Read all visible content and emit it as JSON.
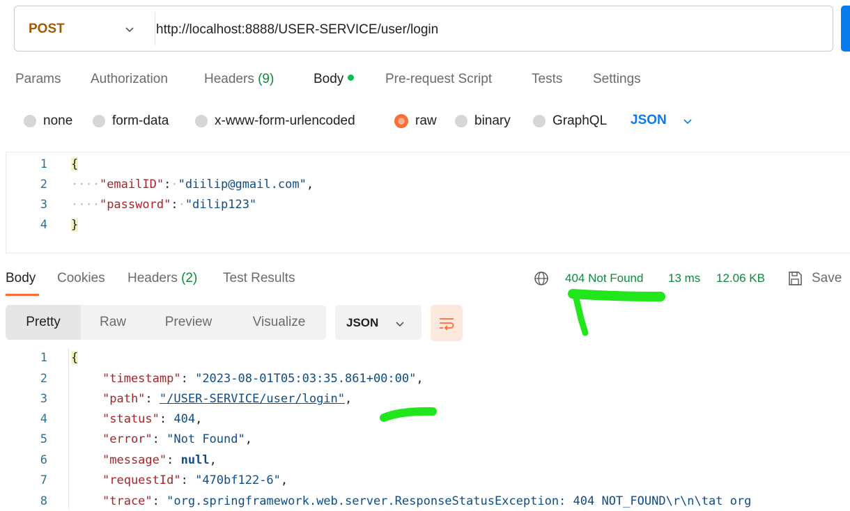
{
  "request": {
    "method": "POST",
    "url": "http://localhost:8888/USER-SERVICE/user/login",
    "tabs": {
      "params": "Params",
      "authorization": "Authorization",
      "headers": "Headers",
      "headers_count": "(9)",
      "body": "Body",
      "prerequest": "Pre-request Script",
      "tests": "Tests",
      "settings": "Settings"
    },
    "body_modes": {
      "none": "none",
      "form_data": "form-data",
      "urlencoded": "x-www-form-urlencoded",
      "raw": "raw",
      "binary": "binary",
      "graphql": "GraphQL",
      "selected": "raw"
    },
    "format": "JSON",
    "lines": [
      {
        "n": "1",
        "text": "{"
      },
      {
        "n": "2",
        "key": "\"emailID\"",
        "value": "\"diilip@gmail.com\""
      },
      {
        "n": "3",
        "key": "\"password\"",
        "value": "\"dilip123\""
      },
      {
        "n": "4",
        "text": "}"
      }
    ]
  },
  "response": {
    "tabs": {
      "body": "Body",
      "cookies": "Cookies",
      "headers": "Headers",
      "headers_count": "(2)",
      "test_results": "Test Results"
    },
    "status": "404 Not Found",
    "time": "13 ms",
    "size": "12.06 KB",
    "save": "Save",
    "views": {
      "pretty": "Pretty",
      "raw": "Raw",
      "preview": "Preview",
      "visualize": "Visualize",
      "selected": "Pretty"
    },
    "format": "JSON",
    "lines": [
      {
        "n": "1",
        "text": "{"
      },
      {
        "n": "2",
        "key": "\"timestamp\"",
        "value": "\"2023-08-01T05:03:35.861+00:00\"",
        "tail": ","
      },
      {
        "n": "3",
        "key": "\"path\"",
        "value": "\"/USER-SERVICE/user/login\"",
        "tail": ","
      },
      {
        "n": "4",
        "key": "\"status\"",
        "value": "404",
        "tail": ","
      },
      {
        "n": "5",
        "key": "\"error\"",
        "value": "\"Not Found\"",
        "tail": ","
      },
      {
        "n": "6",
        "key": "\"message\"",
        "value": "null",
        "tail": ","
      },
      {
        "n": "7",
        "key": "\"requestId\"",
        "value": "\"470bf122-6\"",
        "tail": ","
      },
      {
        "n": "8",
        "key": "\"trace\"",
        "value": "\"org.springframework.web.server.ResponseStatusException: 404 NOT_FOUND\\r\\n\\tat org"
      }
    ]
  },
  "colors": {
    "accent": "#ff6c37",
    "status_green": "#0d8a3c",
    "annotation": "#22e61c",
    "link_blue": "#097bed"
  }
}
